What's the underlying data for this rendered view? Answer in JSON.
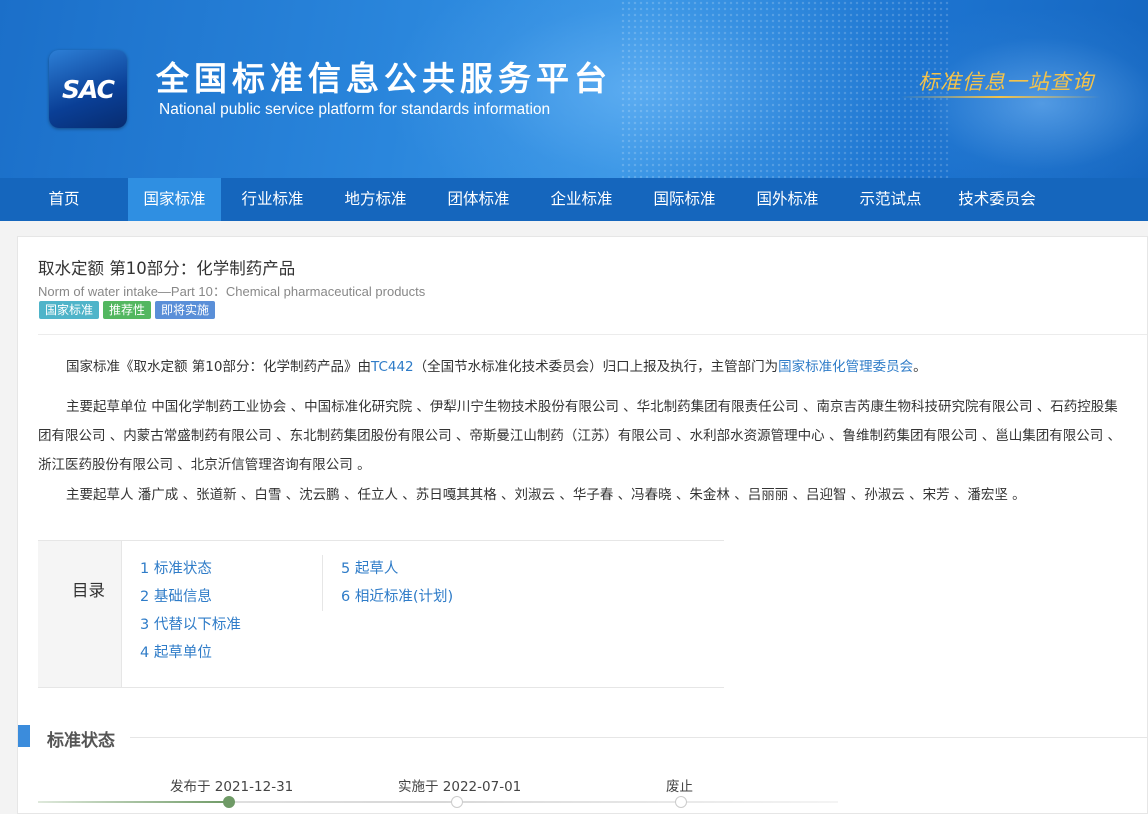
{
  "header": {
    "logo_text": "SAC",
    "title": "全国标准信息公共服务平台",
    "subtitle": "National public service platform  for standards information",
    "slogan": "标准信息一站查询"
  },
  "nav": {
    "items": [
      "首页",
      "国家标准",
      "行业标准",
      "地方标准",
      "团体标准",
      "企业标准",
      "国际标准",
      "国外标准",
      "示范试点",
      "技术委员会"
    ],
    "active_index": 1
  },
  "standard": {
    "title": "取水定额 第10部分：化学制药产品",
    "title_en": "Norm of water intake—Part 10：Chemical pharmaceutical products",
    "badges": [
      "国家标准",
      "推荐性",
      "即将实施"
    ]
  },
  "intro": {
    "prefix": "国家标准《取水定额 第10部分：化学制药产品》由",
    "tc_code": "TC442",
    "middle": "（全国节水标准化技术委员会）归口上报及执行，主管部门为",
    "authority": "国家标准化管理委员会",
    "suffix": "。"
  },
  "drafting_units": "主要起草单位 中国化学制药工业协会 、中国标准化研究院 、伊犁川宁生物技术股份有限公司 、华北制药集团有限责任公司 、南京吉芮康生物科技研究院有限公司 、石药控股集团有限公司 、内蒙古常盛制药有限公司 、东北制药集团股份有限公司 、帝斯曼江山制药（江苏）有限公司 、水利部水资源管理中心 、鲁维制药集团有限公司 、邕山集团有限公司 、浙江医药股份有限公司 、北京沂信管理咨询有限公司 。",
  "drafters": "主要起草人 潘广成 、张道新 、白雪 、沈云鹏 、任立人 、苏日嘎其其格 、刘淑云 、华子春 、冯春晓 、朱金林 、吕丽丽 、吕迎智 、孙淑云 、宋芳 、潘宏坚 。",
  "toc": {
    "label": "目录",
    "col1": [
      "1  标准状态",
      "2  基础信息",
      "3  代替以下标准",
      "4  起草单位"
    ],
    "col2": [
      "5  起草人",
      "6  相近标准(计划)"
    ]
  },
  "section": {
    "status_title": "标准状态"
  },
  "timeline": {
    "stages": [
      "发布于 2021-12-31",
      "实施于 2022-07-01",
      "废止"
    ],
    "completed_stages": 1
  }
}
